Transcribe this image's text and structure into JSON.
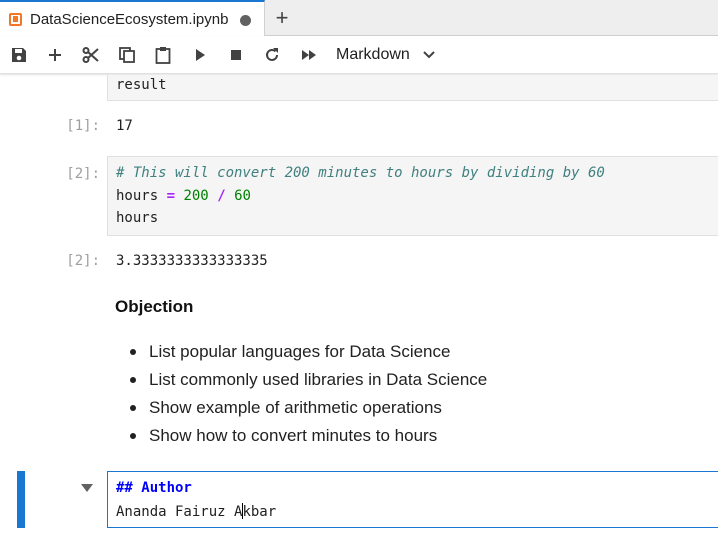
{
  "tab": {
    "title": "DataScienceEcosystem.ipynb",
    "icon": "notebook-icon",
    "dirty_indicator": "unsaved-dot",
    "new_tab_label": "+"
  },
  "toolbar": {
    "buttons": [
      "save-icon",
      "add-cell-icon",
      "cut-icon",
      "copy-icon",
      "paste-icon",
      "run-icon",
      "stop-icon",
      "restart-icon",
      "fast-forward-icon"
    ],
    "cell_type": "Markdown"
  },
  "cells": {
    "prev_code": {
      "line": "result"
    },
    "output1": {
      "prompt": "[1]:",
      "text": "17"
    },
    "code2": {
      "prompt": "[2]:",
      "comment": "# This will convert 200 minutes to hours by dividing by 60",
      "line2_var": "hours ",
      "line2_eq": "=",
      "line2_a": "200",
      "line2_div": "/",
      "line2_b": "60",
      "line3": "hours"
    },
    "output2": {
      "prompt": "[2]:",
      "text": "3.3333333333333335"
    },
    "markdown": {
      "title": "Objection",
      "items": [
        "List popular languages for Data Science",
        "List commonly used libraries in Data Science",
        "Show example of arithmetic operations",
        "Show how to convert minutes to hours"
      ]
    },
    "editing": {
      "line1": "## Author",
      "line2_before": "Ananda Fairuz A",
      "line2_after": "kbar"
    }
  },
  "colors": {
    "accent": "#1976d2",
    "notebook_orange": "#f37726",
    "comment": "#408080",
    "number": "#008000",
    "operator": "#aa22ff",
    "md_header": "#0000ff"
  }
}
